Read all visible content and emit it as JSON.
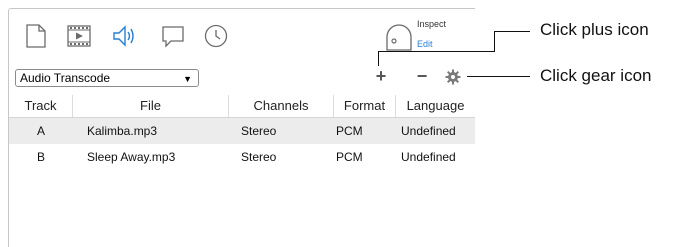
{
  "toolbar": {
    "icons": [
      "document-icon",
      "video-icon",
      "audio-icon",
      "comment-icon",
      "clock-icon"
    ],
    "inspect_label": "Inspect",
    "edit_label": "Edit"
  },
  "controls": {
    "select_value": "Audio Transcode",
    "add_symbol": "+",
    "remove_symbol": "−"
  },
  "table": {
    "headers": [
      "Track",
      "File",
      "Channels",
      "Format",
      "Language"
    ],
    "rows": [
      {
        "track": "A",
        "file": "Kalimba.mp3",
        "channels": "Stereo",
        "format": "PCM",
        "language": "Undefined",
        "selected": true
      },
      {
        "track": "B",
        "file": "Sleep Away.mp3",
        "channels": "Stereo",
        "format": "PCM",
        "language": "Undefined",
        "selected": false
      }
    ]
  },
  "callouts": {
    "plus": "Click plus icon",
    "gear": "Click gear icon"
  },
  "colors": {
    "accent_blue": "#2a7fd4",
    "selected_row": "#ececec",
    "border": "#c7c7c7"
  }
}
